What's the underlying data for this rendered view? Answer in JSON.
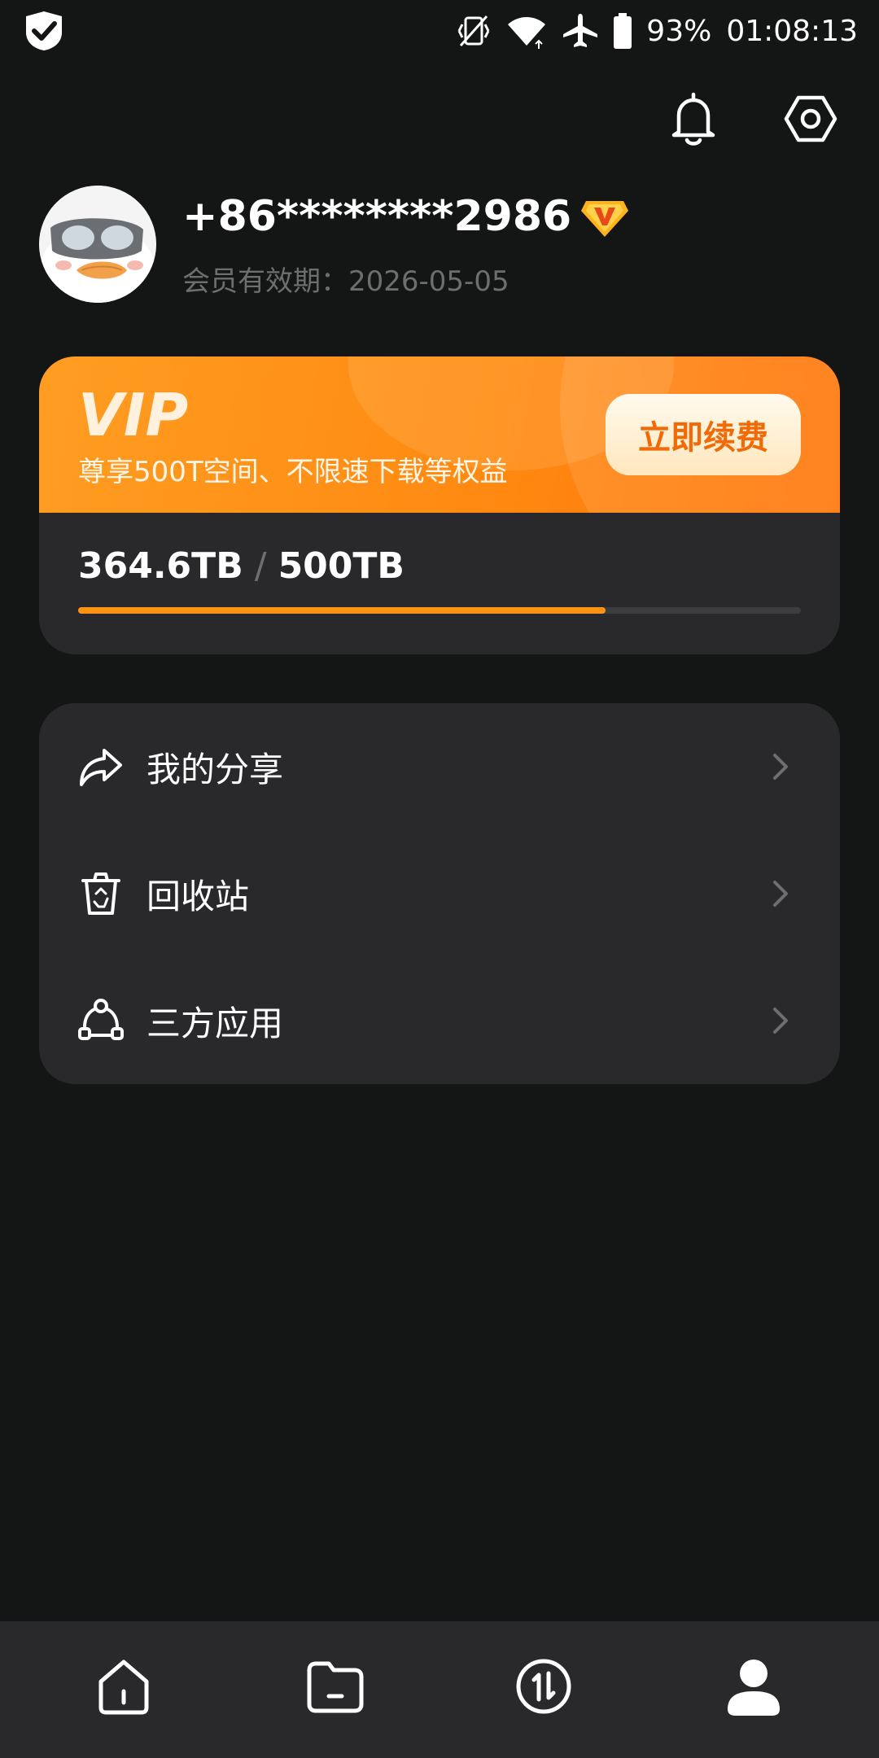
{
  "status_bar": {
    "battery": "93%",
    "time": "01:08:13",
    "icons": [
      "shield-check-icon",
      "mute-icon",
      "wifi-icon",
      "airplane-icon",
      "battery-icon"
    ]
  },
  "header": {
    "icons": [
      "bell-icon",
      "settings-icon"
    ]
  },
  "profile": {
    "phone": "+86********2986",
    "membership_expiry": "会员有效期：2026-05-05"
  },
  "vip_card": {
    "logo_text": "VIP",
    "description": "尊享500T空间、不限速下载等权益",
    "renew_label": "立即续费",
    "used": "364.6TB",
    "separator": "/",
    "total": "500TB",
    "usage_fraction": 0.7292,
    "accent_color": "#ff9414"
  },
  "menu": {
    "items": [
      {
        "label": "我的分享",
        "icon": "share-icon"
      },
      {
        "label": "回收站",
        "icon": "recycle-bin-icon"
      },
      {
        "label": "三方应用",
        "icon": "third-party-apps-icon"
      }
    ]
  },
  "bottom_nav": {
    "items": [
      {
        "icon": "home-icon"
      },
      {
        "icon": "files-icon"
      },
      {
        "icon": "transfer-icon"
      },
      {
        "icon": "profile-icon",
        "active": true
      }
    ]
  }
}
